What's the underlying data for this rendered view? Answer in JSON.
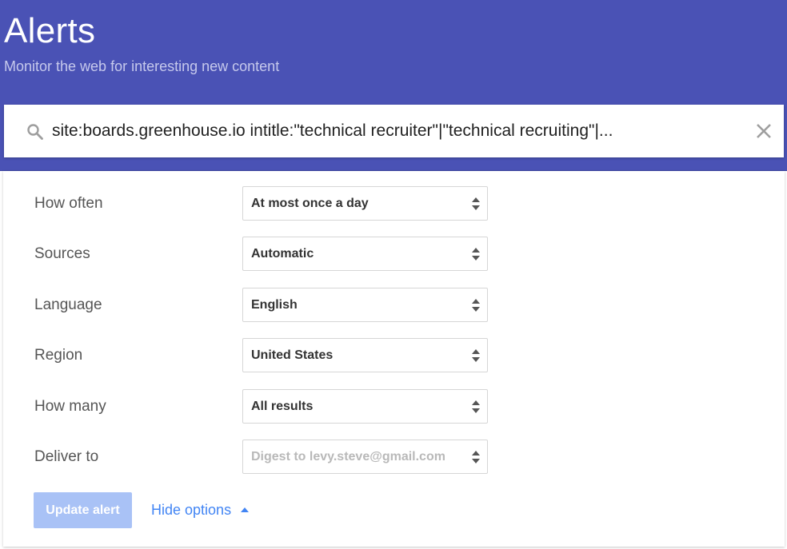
{
  "header": {
    "title": "Alerts",
    "subtitle": "Monitor the web for interesting new content"
  },
  "search": {
    "query": "site:boards.greenhouse.io intitle:\"technical recruiter\"|\"technical recruiting\"|..."
  },
  "options": [
    {
      "label": "How often",
      "value": "At most once a day",
      "disabled": false
    },
    {
      "label": "Sources",
      "value": "Automatic",
      "disabled": false
    },
    {
      "label": "Language",
      "value": "English",
      "disabled": false
    },
    {
      "label": "Region",
      "value": "United States",
      "disabled": false
    },
    {
      "label": "How many",
      "value": "All results",
      "disabled": false
    },
    {
      "label": "Deliver to",
      "value": "Digest to levy.steve@gmail.com",
      "disabled": true
    }
  ],
  "actions": {
    "update_label": "Update alert",
    "hide_options_label": "Hide options"
  },
  "colors": {
    "header_bg": "#4a52b5",
    "link": "#4285f4",
    "button_disabled": "#a9c2f6"
  },
  "icons": {
    "search": "search-icon",
    "clear": "close-icon",
    "select_arrow": "updown-arrow-icon",
    "collapse": "caret-up-icon"
  }
}
